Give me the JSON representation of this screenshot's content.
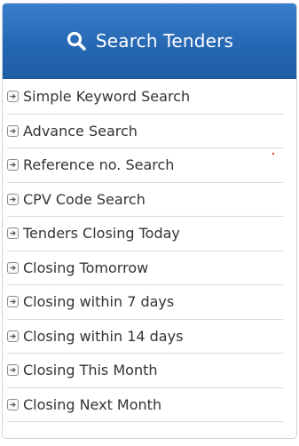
{
  "header": {
    "title": "Search Tenders",
    "icon": "search-icon"
  },
  "menu": {
    "items": [
      {
        "label": "Simple Keyword Search",
        "icon": "arrow-right-icon"
      },
      {
        "label": "Advance Search",
        "icon": "arrow-right-icon"
      },
      {
        "label": "Reference no. Search",
        "icon": "arrow-right-icon"
      },
      {
        "label": "CPV Code Search",
        "icon": "arrow-right-icon"
      },
      {
        "label": "Tenders Closing Today",
        "icon": "arrow-right-icon"
      },
      {
        "label": "Closing Tomorrow",
        "icon": "arrow-right-icon"
      },
      {
        "label": "Closing within 7 days",
        "icon": "arrow-right-icon"
      },
      {
        "label": "Closing within 14 days",
        "icon": "arrow-right-icon"
      },
      {
        "label": "Closing This Month",
        "icon": "arrow-right-icon"
      },
      {
        "label": "Closing Next Month",
        "icon": "arrow-right-icon"
      }
    ]
  },
  "colors": {
    "header_bg": "#2668b3",
    "header_text": "#ffffff",
    "item_text": "#333333",
    "divider": "#d9d9d9"
  }
}
